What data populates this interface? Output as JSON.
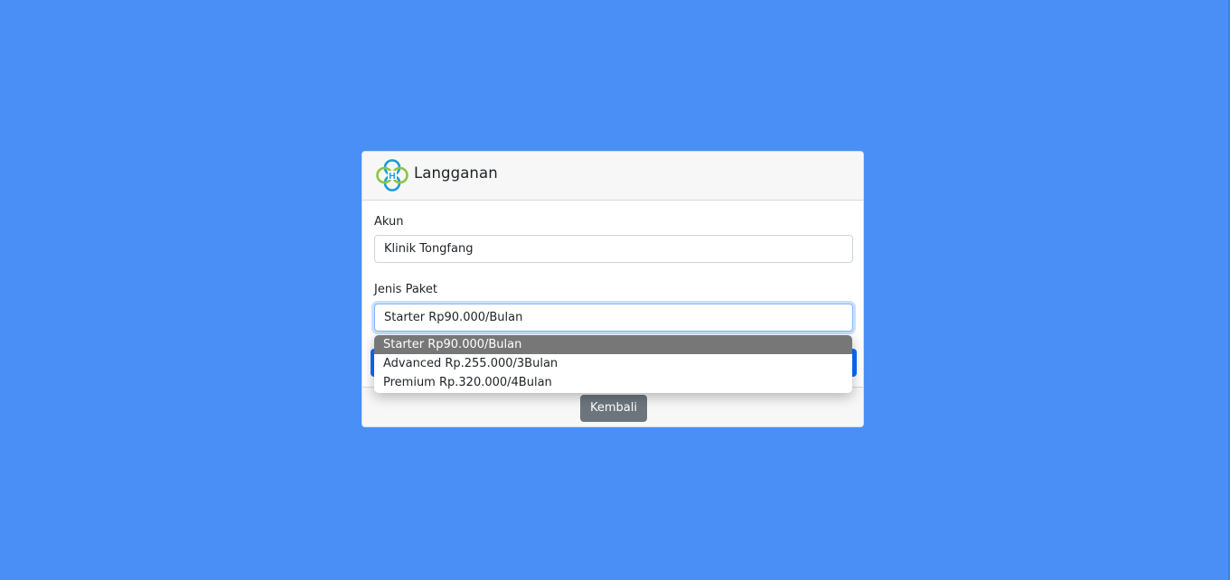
{
  "header": {
    "title": "Langganan",
    "logo_icon": "clinic-logo-icon"
  },
  "form": {
    "account": {
      "label": "Akun",
      "value": "Klinik Tongfang"
    },
    "package": {
      "label": "Jenis Paket",
      "value": "Starter Rp90.000/Bulan",
      "options": [
        "Starter Rp90.000/Bulan",
        "Advanced Rp.255.000/3Bulan",
        "Premium Rp.320.000/4Bulan"
      ],
      "selected_index": 0
    }
  },
  "footer": {
    "back_label": "Kembali"
  },
  "colors": {
    "background": "#4a8ff5",
    "primary": "#0d6efd",
    "secondary": "#6c757d",
    "logo_green": "#8cc63f",
    "logo_blue": "#1d9bd7"
  }
}
